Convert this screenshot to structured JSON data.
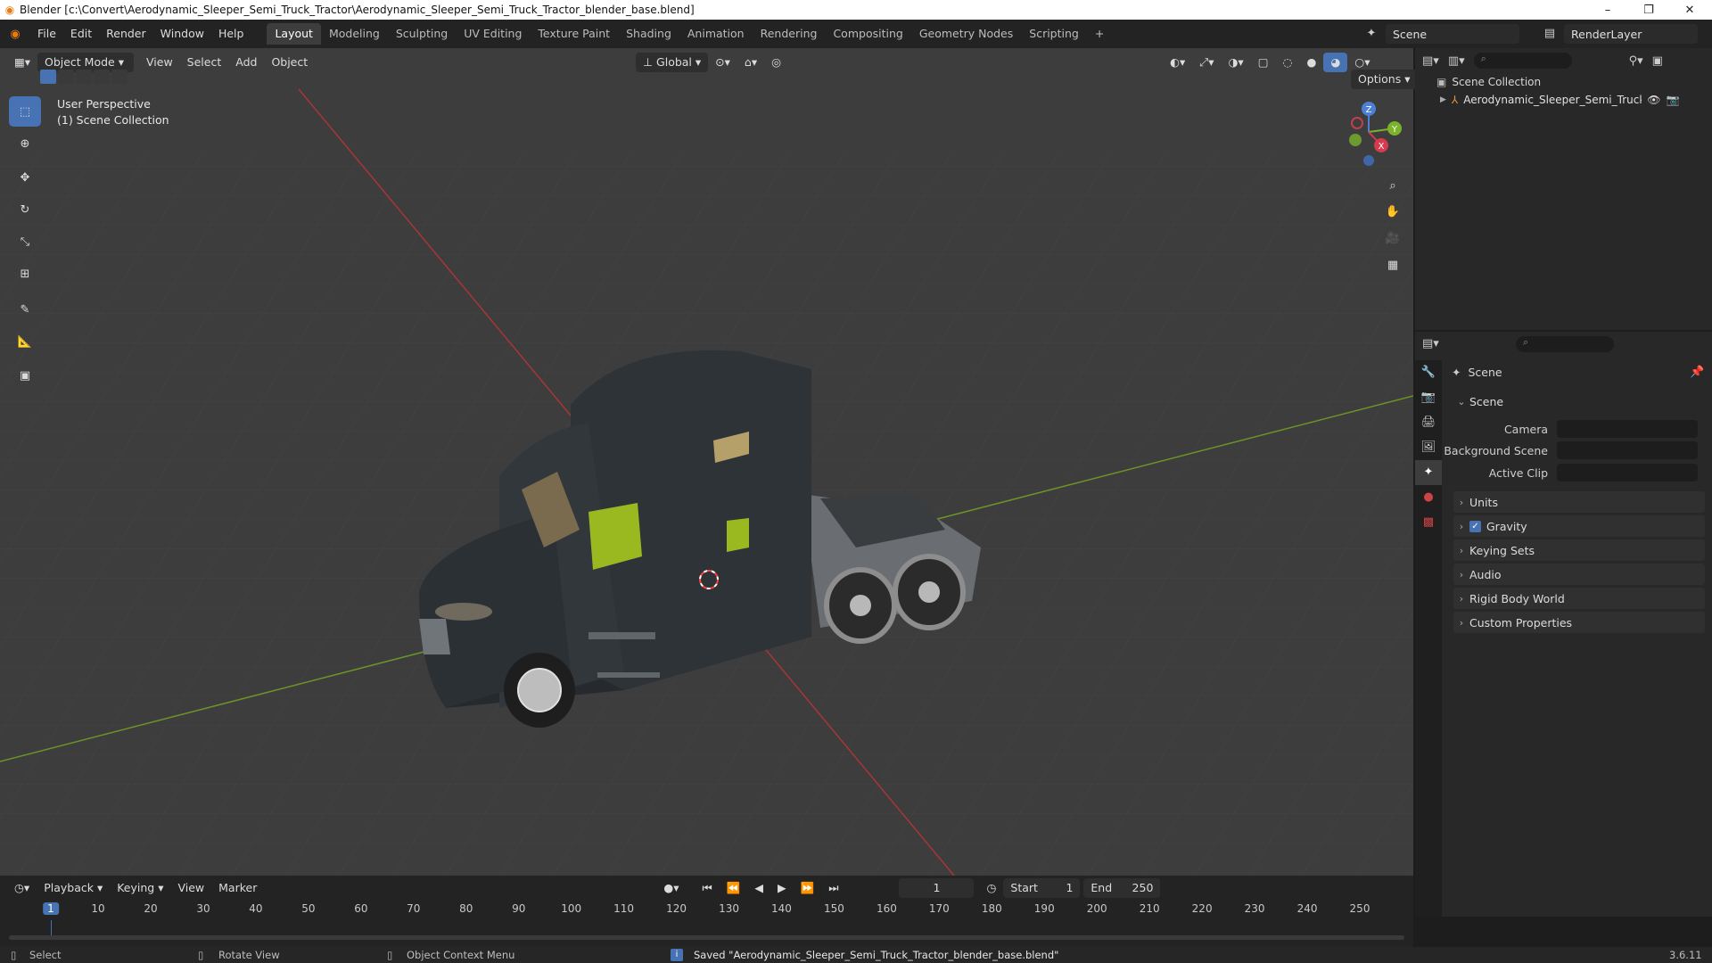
{
  "window": {
    "title": "Blender [c:\\Convert\\Aerodynamic_Sleeper_Semi_Truck_Tractor\\Aerodynamic_Sleeper_Semi_Truck_Tractor_blender_base.blend]",
    "controls": [
      "–",
      "❐",
      "✕"
    ]
  },
  "menubar": {
    "items": [
      "File",
      "Edit",
      "Render",
      "Window",
      "Help"
    ]
  },
  "workspaces": {
    "tabs": [
      "Layout",
      "Modeling",
      "Sculpting",
      "UV Editing",
      "Texture Paint",
      "Shading",
      "Animation",
      "Rendering",
      "Compositing",
      "Geometry Nodes",
      "Scripting"
    ],
    "active": "Layout",
    "add": "+"
  },
  "scene_selector": {
    "scene": "Scene",
    "view_layer": "RenderLayer"
  },
  "viewport_header": {
    "mode": "Object Mode",
    "menus": [
      "View",
      "Select",
      "Add",
      "Object"
    ],
    "transform_orientation": "Global",
    "options": "Options"
  },
  "viewport": {
    "info_line1": "User Perspective",
    "info_line2": "(1) Scene Collection",
    "gizmo": {
      "x": "X",
      "y": "Y",
      "z": "Z"
    },
    "colors": {
      "bg": "#3d3d3d",
      "grid": "#4a4a4a",
      "x_axis": "#b43a3a",
      "y_axis": "#6c9a2a"
    }
  },
  "outliner": {
    "root": "Scene Collection",
    "items": [
      {
        "label": "Aerodynamic_Sleeper_Semi_Truck_Trac"
      }
    ]
  },
  "properties": {
    "header": "Scene",
    "section_open": "Scene",
    "fields": [
      {
        "label": "Camera"
      },
      {
        "label": "Background Scene"
      },
      {
        "label": "Active Clip"
      }
    ],
    "sections": [
      "Units",
      "Gravity",
      "Keying Sets",
      "Audio",
      "Rigid Body World",
      "Custom Properties"
    ],
    "gravity_checked": true
  },
  "timeline": {
    "menus": [
      "Playback",
      "Keying",
      "View",
      "Marker"
    ],
    "current_frame": "1",
    "start_label": "Start",
    "start": "1",
    "end_label": "End",
    "end": "250",
    "ticks": [
      "1",
      "10",
      "20",
      "30",
      "40",
      "50",
      "60",
      "70",
      "80",
      "90",
      "100",
      "110",
      "120",
      "130",
      "140",
      "150",
      "160",
      "170",
      "180",
      "190",
      "200",
      "210",
      "220",
      "230",
      "240",
      "250"
    ]
  },
  "statusbar": {
    "select": "Select",
    "rotate": "Rotate View",
    "context": "Object Context Menu",
    "message": "Saved \"Aerodynamic_Sleeper_Semi_Truck_Tractor_blender_base.blend\"",
    "version": "3.6.11"
  }
}
